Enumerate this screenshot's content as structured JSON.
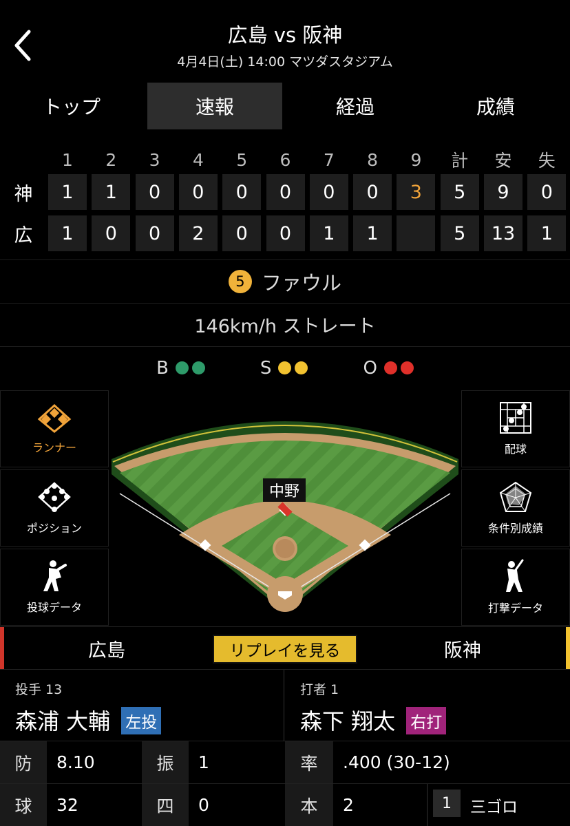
{
  "header": {
    "title": "広島 vs 阪神",
    "subtitle": "4月4日(土) 14:00 マツダスタジアム"
  },
  "tabs": [
    "トップ",
    "速報",
    "経過",
    "成績"
  ],
  "active_tab": "速報",
  "scoreboard": {
    "headers": [
      "1",
      "2",
      "3",
      "4",
      "5",
      "6",
      "7",
      "8",
      "9",
      "計",
      "安",
      "失"
    ],
    "rows": [
      {
        "team": "神",
        "cells": [
          "1",
          "1",
          "0",
          "0",
          "0",
          "0",
          "0",
          "0",
          "3",
          "5",
          "9",
          "0"
        ]
      },
      {
        "team": "広",
        "cells": [
          "1",
          "0",
          "0",
          "2",
          "0",
          "0",
          "1",
          "1",
          "",
          "5",
          "13",
          "1"
        ]
      }
    ]
  },
  "play": {
    "pitch_number": "5",
    "result": "ファウル",
    "pitch_info": "146km/h ストレート"
  },
  "count": {
    "b_label": "B",
    "s_label": "S",
    "o_label": "O",
    "b_color": "#2e9b6a",
    "s_color": "#f2c230",
    "o_color": "#e0302a"
  },
  "field": {
    "fielder_label": "中野"
  },
  "side_buttons": {
    "runner": "ランナー",
    "position": "ポジション",
    "pitching_data": "投球データ",
    "pitch_chart": "配球",
    "conditional": "条件別成績",
    "batting_data": "打撃データ"
  },
  "teambar": {
    "home": "広島",
    "replay": "リプレイを見る",
    "away": "阪神"
  },
  "pitcher": {
    "role": "投手 13",
    "name": "森浦 大輔",
    "hand": "左投",
    "hand_color": "#2f6fb5"
  },
  "batter": {
    "role": "打者 1",
    "name": "森下 翔太",
    "hand": "右打",
    "hand_color": "#a0237a"
  },
  "pitcher_stats": [
    {
      "label": "防",
      "value": "8.10"
    },
    {
      "label": "振",
      "value": "1"
    },
    {
      "label": "球",
      "value": "32"
    },
    {
      "label": "四",
      "value": "0"
    }
  ],
  "batter_stats": [
    {
      "label": "率",
      "value": ".400 (30-12)"
    },
    {
      "label": "本",
      "value": "2"
    }
  ],
  "at_bat_history": [
    {
      "inning": "1",
      "result": "三ゴロ"
    }
  ]
}
